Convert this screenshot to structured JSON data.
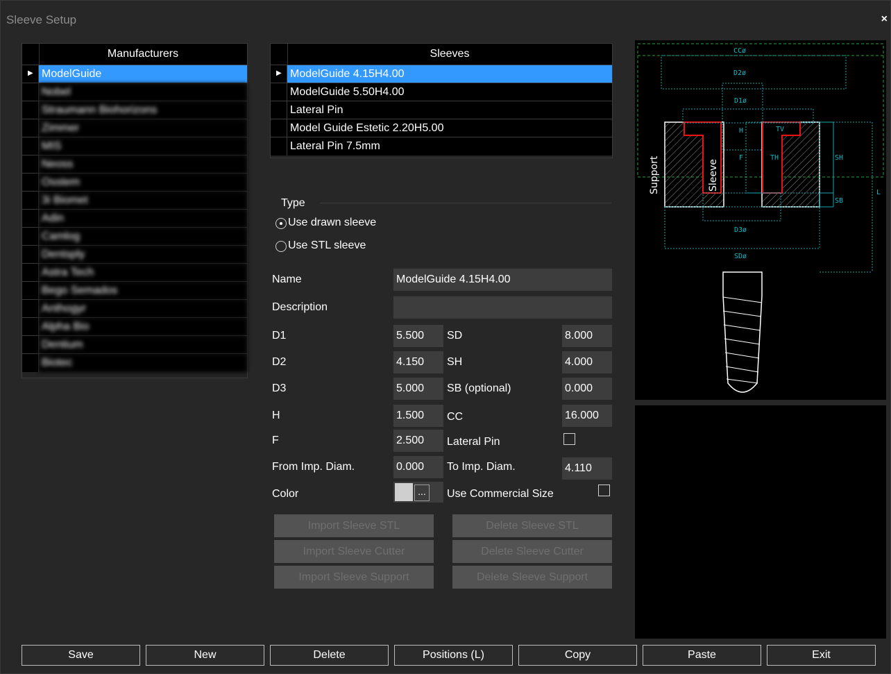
{
  "window": {
    "title": "Sleeve Setup",
    "close_label": "×"
  },
  "manufacturers": {
    "header": "Manufacturers",
    "rows": [
      "ModelGuide",
      "Nobel",
      "Straumann Biohorizons",
      "Zimmer",
      "MIS",
      "Neoss",
      "Osstem",
      "3i Biomet",
      "Adin",
      "Camlog",
      "Dentsply",
      "Astra Tech",
      "Bego Semados",
      "Anthogyr",
      "Alpha Bio",
      "Dentium",
      "Biotec"
    ]
  },
  "sleeves": {
    "header": "Sleeves",
    "rows": [
      "ModelGuide 4.15H4.00",
      "ModelGuide 5.50H4.00",
      "Lateral Pin",
      "Model Guide Estetic 2.20H5.00",
      "Lateral Pin 7.5mm"
    ]
  },
  "type": {
    "group_label": "Type",
    "option_drawn": "Use drawn sleeve",
    "option_stl": "Use STL sleeve",
    "selected": "drawn"
  },
  "form": {
    "name_label": "Name",
    "name_value": "ModelGuide 4.15H4.00",
    "description_label": "Description",
    "description_value": "",
    "d1_label": "D1",
    "d1_value": "5.500",
    "d2_label": "D2",
    "d2_value": "4.150",
    "d3_label": "D3",
    "d3_value": "5.000",
    "h_label": "H",
    "h_value": "1.500",
    "f_label": "F",
    "f_value": "2.500",
    "from_label": "From Imp. Diam.",
    "from_value": "0.000",
    "sd_label": "SD",
    "sd_value": "8.000",
    "sh_label": "SH",
    "sh_value": "4.000",
    "sb_label": "SB (optional)",
    "sb_value": "0.000",
    "cc_label": "CC",
    "cc_value": "16.000",
    "lateral_label": "Lateral Pin",
    "lateral_checked": false,
    "to_label": "To Imp. Diam.",
    "to_value": "4.110",
    "color_label": "Color",
    "color_value": "#cfcfcf",
    "color_button": "...",
    "commercial_label": "Use Commercial Size",
    "commercial_checked": false
  },
  "stl_buttons": {
    "import_stl": "Import Sleeve STL",
    "delete_stl": "Delete Sleeve STL",
    "import_cutter": "Import Sleeve Cutter",
    "delete_cutter": "Delete Sleeve Cutter",
    "import_support": "Import Sleeve Support",
    "delete_support": "Delete Sleeve Support"
  },
  "diagram": {
    "cc": "CCø",
    "d2": "D2ø",
    "d1": "D1ø",
    "h": "H",
    "tv": "TV",
    "f": "F",
    "th": "TH",
    "sh": "SH",
    "l": "L",
    "sb": "SB",
    "d3": "D3ø",
    "sd": "SDø",
    "support": "Support",
    "sleeve": "Sleeve"
  },
  "bottom_buttons": {
    "save": "Save",
    "new": "New",
    "delete": "Delete",
    "positions": "Positions (L)",
    "copy": "Copy",
    "paste": "Paste",
    "exit": "Exit"
  }
}
